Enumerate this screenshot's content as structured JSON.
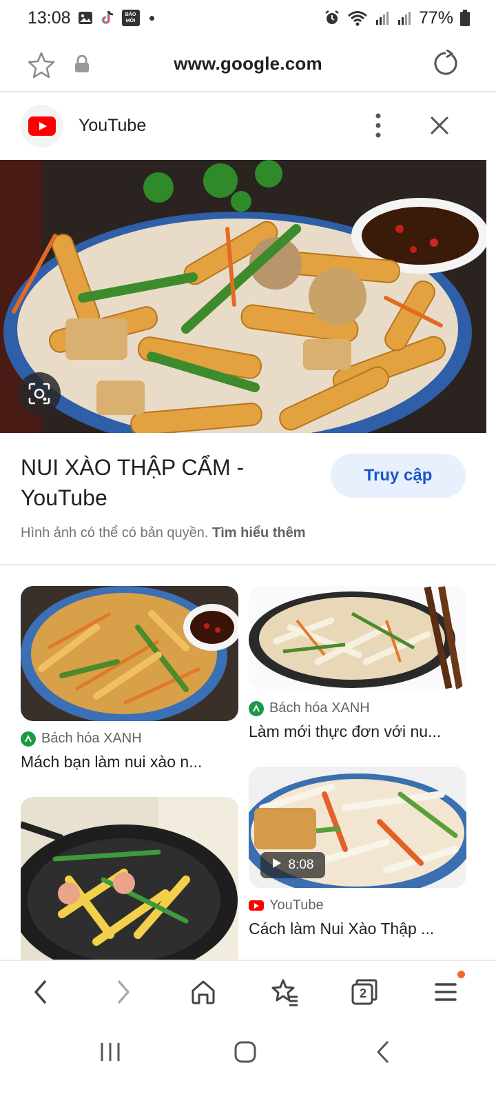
{
  "status_bar": {
    "time": "13:08",
    "battery": "77%"
  },
  "url_bar": {
    "url": "www.google.com"
  },
  "source": {
    "name": "YouTube"
  },
  "result": {
    "title": "NUI XÀO THẬP CẨM - YouTube",
    "visit_label": "Truy cập",
    "copyright_text": "Hình ảnh có thể có bản quyền.",
    "learn_more": "Tìm hiểu thêm"
  },
  "related": [
    {
      "source": "Bách hóa XANH",
      "title": "Mách bạn làm nui xào n..."
    },
    {
      "source": "Bách hóa XANH",
      "title": "Làm mới thực đơn với nu..."
    },
    {
      "source": "YouTube",
      "title": "Cách làm Nui Xào Thập ...",
      "duration": "8:08"
    },
    {
      "source": "",
      "title": ""
    }
  ],
  "bottom_nav": {
    "tabs_count": "2"
  },
  "colors": {
    "accent": "#1a57c9",
    "visit_bg": "#e8f0fe",
    "youtube_red": "#ff0000",
    "bhx_green": "#1a9a45"
  }
}
